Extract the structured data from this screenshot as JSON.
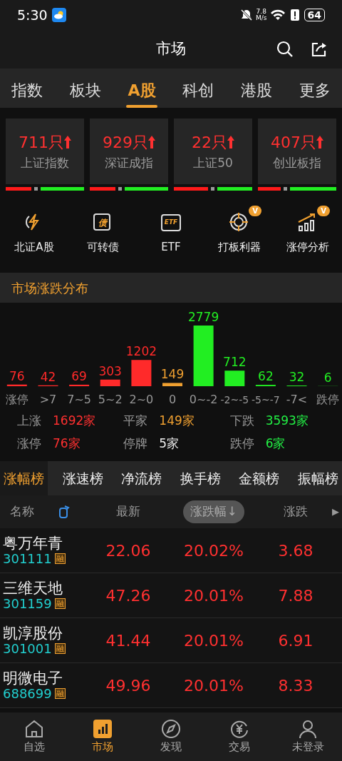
{
  "status_bar": {
    "time": "5:30",
    "speed_value": "7.8",
    "speed_unit": "M/s",
    "battery": "64"
  },
  "header": {
    "title": "市场"
  },
  "tabs": [
    {
      "label": "指数",
      "selected": false
    },
    {
      "label": "板块",
      "selected": false
    },
    {
      "label": "A股",
      "selected": true
    },
    {
      "label": "科创",
      "selected": false
    },
    {
      "label": "港股",
      "selected": false
    },
    {
      "label": "更多",
      "selected": false
    }
  ],
  "index_cards": [
    {
      "count": "711只",
      "name": "上证指数",
      "level": 0.33
    },
    {
      "count": "929只",
      "name": "深证成指",
      "level": 0.33
    },
    {
      "count": "22只",
      "name": "上证50",
      "level": 0.44
    },
    {
      "count": "407只",
      "name": "创业板指",
      "level": 0.29
    }
  ],
  "shortcuts": [
    {
      "label": "北证A股",
      "kind": "bolt"
    },
    {
      "label": "可转债",
      "kind": "bond",
      "icon_text": "债"
    },
    {
      "label": "ETF",
      "kind": "etf",
      "icon_text": "ETF"
    },
    {
      "label": "打板利器",
      "kind": "target",
      "badge": "V"
    },
    {
      "label": "涨停分析",
      "kind": "growth",
      "badge": "V"
    }
  ],
  "distribution": {
    "title": "市场涨跌分布",
    "chart_data": {
      "type": "bar",
      "data_labels": true,
      "categories": [
        "涨停",
        ">7",
        "7~5",
        "5~2",
        "2~0",
        "0",
        "0~-2",
        "-2~-5",
        "-5~-7",
        "-7<",
        "跌停"
      ],
      "series": [
        {
          "color": "#ff2a2a",
          "values": [
            76,
            42,
            69,
            303,
            1202,
            null,
            null,
            null,
            null,
            null,
            null
          ]
        },
        {
          "color": "#f0a030",
          "values": [
            null,
            null,
            null,
            null,
            null,
            149,
            null,
            null,
            null,
            null,
            null
          ]
        },
        {
          "color": "#22ee22",
          "values": [
            null,
            null,
            null,
            null,
            null,
            null,
            2779,
            712,
            62,
            32,
            6
          ]
        }
      ]
    },
    "stats": [
      {
        "label": "上涨",
        "value": "1692家",
        "color": "#ff3030"
      },
      {
        "label": "平家",
        "value": "149家",
        "color": "#f0a030"
      },
      {
        "label": "下跌",
        "value": "3593家",
        "color": "#22ee44"
      },
      {
        "label": "涨停",
        "value": "76家",
        "color": "#ff3030"
      },
      {
        "label": "停牌",
        "value": "5家",
        "color": "#eeeeee"
      },
      {
        "label": "跌停",
        "value": "6家",
        "color": "#22ee44"
      }
    ]
  },
  "board_tabs": [
    {
      "label": "涨幅榜",
      "selected": true
    },
    {
      "label": "涨速榜",
      "selected": false
    },
    {
      "label": "净流榜",
      "selected": false
    },
    {
      "label": "换手榜",
      "selected": false
    },
    {
      "label": "金额榜",
      "selected": false
    },
    {
      "label": "振幅榜",
      "selected": false
    }
  ],
  "table": {
    "columns": [
      {
        "label": "名称",
        "selected": false
      },
      {
        "label": "最新",
        "selected": false
      },
      {
        "label": "涨跌幅↓",
        "selected": true
      },
      {
        "label": "涨跌",
        "selected": false
      }
    ],
    "more_arrow": "▶",
    "rows": [
      {
        "name": "粤万年青",
        "code": "301111",
        "tag": "融",
        "price": "22.06",
        "change_pct": "20.02%",
        "change": "3.68"
      },
      {
        "name": "三维天地",
        "code": "301159",
        "tag": "融",
        "price": "47.26",
        "change_pct": "20.01%",
        "change": "7.88"
      },
      {
        "name": "凯淳股份",
        "code": "301001",
        "tag": "融",
        "price": "41.44",
        "change_pct": "20.01%",
        "change": "6.91"
      },
      {
        "name": "明微电子",
        "code": "688699",
        "tag": "融",
        "price": "49.96",
        "change_pct": "20.01%",
        "change": "8.33"
      }
    ]
  },
  "bottom_nav": [
    {
      "label": "自选",
      "kind": "home",
      "selected": false
    },
    {
      "label": "市场",
      "kind": "chart",
      "selected": true
    },
    {
      "label": "发现",
      "kind": "compass",
      "selected": false
    },
    {
      "label": "交易",
      "kind": "yen",
      "selected": false
    },
    {
      "label": "未登录",
      "kind": "user",
      "selected": false
    }
  ]
}
